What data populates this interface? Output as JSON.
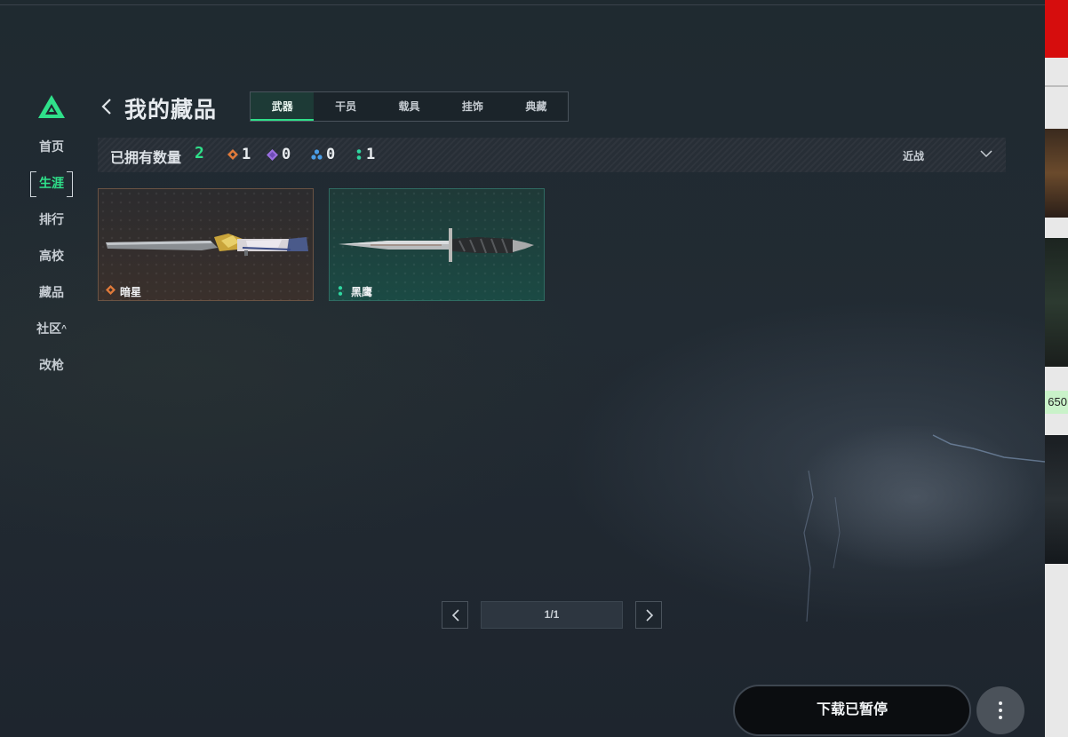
{
  "sidebar": {
    "items": [
      {
        "label": "首页",
        "active": false
      },
      {
        "label": "生涯",
        "active": true
      },
      {
        "label": "排行",
        "active": false
      },
      {
        "label": "高校",
        "active": false
      },
      {
        "label": "藏品",
        "active": false
      },
      {
        "label": "社区",
        "active": false,
        "suffix": "^"
      },
      {
        "label": "改枪",
        "active": false
      }
    ]
  },
  "header": {
    "title": "我的藏品",
    "tabs": [
      {
        "label": "武器",
        "active": true
      },
      {
        "label": "干员",
        "active": false
      },
      {
        "label": "载具",
        "active": false
      },
      {
        "label": "挂饰",
        "active": false
      },
      {
        "label": "典藏",
        "active": false
      }
    ]
  },
  "stats": {
    "owned_label": "已拥有数量",
    "owned_count": "2",
    "rarity_counts": [
      {
        "icon": "orange-diamond-icon",
        "color": "#e07a3a",
        "count": "1"
      },
      {
        "icon": "purple-diamond-icon",
        "color": "#9a6fe0",
        "count": "0"
      },
      {
        "icon": "blue-triangle-icon",
        "color": "#4a9ee8",
        "count": "0"
      },
      {
        "icon": "teal-dots-icon",
        "color": "#2fd6a0",
        "count": "1"
      }
    ],
    "filter_value": "近战"
  },
  "items": [
    {
      "name": "暗星",
      "rarity_icon": "orange-diamond-icon",
      "rarity_color": "#e07a3a",
      "image": "ornate-knife"
    },
    {
      "name": "黑鹰",
      "rarity_icon": "teal-dots-icon",
      "rarity_color": "#2fd6a0",
      "image": "combat-knife"
    }
  ],
  "pagination": {
    "display": "1/1"
  },
  "download": {
    "label": "下载已暂停"
  },
  "colors": {
    "accent": "#2fe08a",
    "background": "#1f2830"
  },
  "external": {
    "partial_number": "650"
  }
}
